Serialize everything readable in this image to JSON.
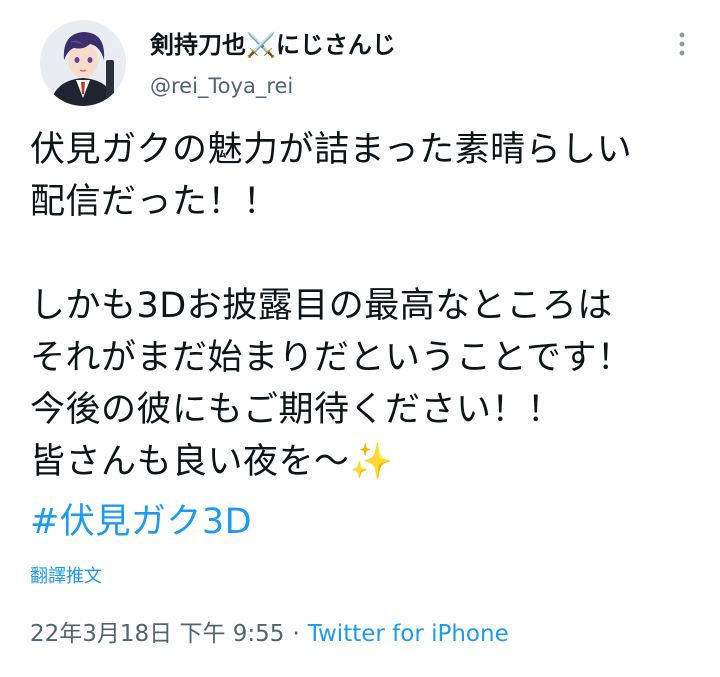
{
  "author": {
    "display_name": "剣持刀也⚔️にじさんじ",
    "handle": "@rei_Toya_rei"
  },
  "tweet": {
    "lines": [
      "伏見ガクの魅力が詰まった素晴らしい",
      "配信だった！！",
      "",
      "しかも3Dお披露目の最高なところは",
      "それがまだ始まりだということです！",
      "今後の彼にもご期待ください！！",
      "皆さんも良い夜を〜✨"
    ],
    "hashtag": "#伏見ガク3D"
  },
  "translate_label": "翻譯推文",
  "meta": {
    "timestamp": "22年3月18日 下午 9:55",
    "separator": "·",
    "source": "Twitter for iPhone"
  },
  "colors": {
    "link": "#1d9bf0",
    "secondary_text": "#536471",
    "primary_text": "#0f1419"
  },
  "icons": {
    "more": "more-vertical-icon",
    "sparkles": "sparkles-emoji"
  }
}
